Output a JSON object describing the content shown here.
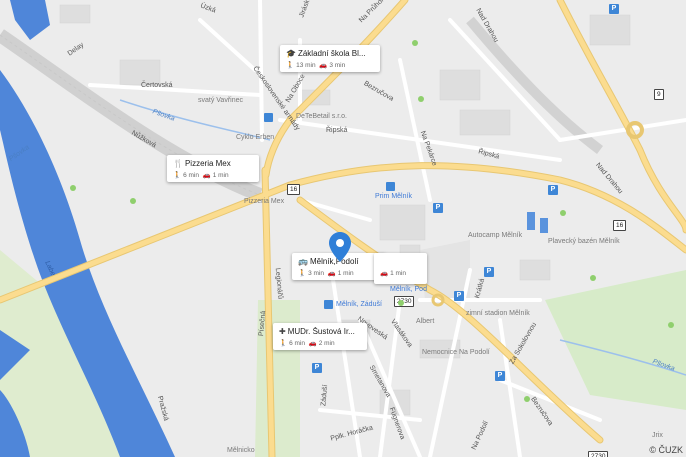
{
  "map": {
    "attribution": "© ČUZK",
    "street_labels": [
      {
        "id": "delay",
        "text": "Delay"
      },
      {
        "id": "certovska",
        "text": "Čertovská"
      },
      {
        "id": "nuzkova",
        "text": "Nůžková"
      },
      {
        "id": "uzka",
        "text": "Úzká"
      },
      {
        "id": "cs-armady",
        "text": "Československé armády"
      },
      {
        "id": "na-oboce",
        "text": "Na Oboce"
      },
      {
        "id": "na-pruhone",
        "text": "Na Průhoně"
      },
      {
        "id": "bezrucova",
        "text": "Bezručova"
      },
      {
        "id": "jiraskova",
        "text": "Jiráskova"
      },
      {
        "id": "rypska",
        "text": "Řipská"
      },
      {
        "id": "ripska2",
        "text": "Řipská"
      },
      {
        "id": "nad-drahou",
        "text": "Nad Drahou"
      },
      {
        "id": "nad-drahou2",
        "text": "Nad Drahou"
      },
      {
        "id": "na-pekarce",
        "text": "Na Pekárce"
      },
      {
        "id": "novoveska",
        "text": "Novoveská"
      },
      {
        "id": "pisecna",
        "text": "Písečná"
      },
      {
        "id": "prazska",
        "text": "Pražská"
      },
      {
        "id": "legionarska",
        "text": "Legionářů"
      },
      {
        "id": "zaduli",
        "text": "Záduší"
      },
      {
        "id": "vlasakova",
        "text": "Vlasákova"
      },
      {
        "id": "smetanova",
        "text": "Smetanova"
      },
      {
        "id": "fugnerova",
        "text": "Fügnerova"
      },
      {
        "id": "pplk-horacka",
        "text": "Pplk. Horáčka"
      },
      {
        "id": "na-podoli",
        "text": "Na Podolí"
      },
      {
        "id": "kratka",
        "text": "Krátká"
      },
      {
        "id": "za-sokolovnou",
        "text": "Za Sokolovnou"
      },
      {
        "id": "bezrucova2",
        "text": "Bezručova"
      },
      {
        "id": "psovka",
        "text": "Pšovka"
      },
      {
        "id": "psovka2",
        "text": "Pšovka"
      },
      {
        "id": "labe",
        "text": "Labe"
      },
      {
        "id": "psovka3",
        "text": "Pšovka"
      }
    ],
    "poi_labels": [
      {
        "id": "svaty-vavrinec",
        "text": "svatý Vavřinec"
      },
      {
        "id": "cyklo-erben",
        "text": "Cyklo Erben"
      },
      {
        "id": "detebetail",
        "text": "DeTeBetail s.r.o."
      },
      {
        "id": "prim-melnik",
        "text": "Prim Mělník"
      },
      {
        "id": "pizzeria-mex-map",
        "text": "Pizzeria Mex"
      },
      {
        "id": "autocamp",
        "text": "Autocamp Mělník"
      },
      {
        "id": "plavecky-bazen",
        "text": "Plavecký bazén Mělník"
      },
      {
        "id": "melnik-pod",
        "text": "Mělník, Pod"
      },
      {
        "id": "melnik-zaduli",
        "text": "Mělník, Záduší"
      },
      {
        "id": "albert",
        "text": "Albert"
      },
      {
        "id": "zimni-stadion",
        "text": "zimní stadion Mělník"
      },
      {
        "id": "nemocnice",
        "text": "Nemocnice Na Podolí"
      },
      {
        "id": "jrix",
        "text": "Jrix"
      },
      {
        "id": "melnicko",
        "text": "Mělnicko"
      }
    ],
    "road_shields": [
      {
        "id": "r16a",
        "text": "16"
      },
      {
        "id": "r16b",
        "text": "16"
      },
      {
        "id": "r9",
        "text": "9"
      },
      {
        "id": "r2730a",
        "text": "2730"
      },
      {
        "id": "r2730b",
        "text": "2730"
      }
    ]
  },
  "cards": [
    {
      "id": "zakladni",
      "icon": "graduation-cap-icon",
      "title": "Základní škola Bl...",
      "walk": "13 min",
      "car": "3 min"
    },
    {
      "id": "pizzeria",
      "icon": "restaurant-icon",
      "title": "Pizzeria Mex",
      "walk": "6 min",
      "car": "1 min"
    },
    {
      "id": "melnik-podoli",
      "icon": "bus-icon",
      "title": "Mělník,Podolí",
      "walk": "3 min",
      "car": "1 min"
    },
    {
      "id": "extra",
      "icon": "",
      "title": "",
      "walk": "",
      "car": "1 min"
    },
    {
      "id": "mudr",
      "icon": "medical-cross-icon",
      "title": "MUDr. Šustová Ir...",
      "walk": "6 min",
      "car": "2 min"
    }
  ],
  "icons": {
    "walk": "walk-icon",
    "car": "car-icon",
    "marker": "location-pin-icon",
    "parking": "P"
  },
  "colors": {
    "water": "#4f86d9",
    "water_light": "#a9c7ee",
    "road_major": "#fbdc8f",
    "road_minor": "#ffffff",
    "park": "#d7ebc9",
    "marker": "#2f7fd8"
  }
}
